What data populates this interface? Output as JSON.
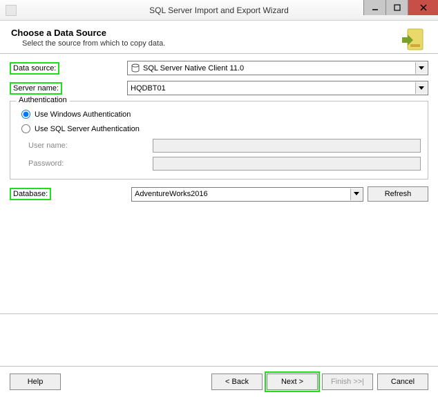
{
  "window": {
    "title": "SQL Server Import and Export Wizard"
  },
  "header": {
    "title": "Choose a Data Source",
    "subtitle": "Select the source from which to copy data."
  },
  "form": {
    "data_source_label": "Data source:",
    "data_source_value": "SQL Server Native Client 11.0",
    "server_name_label": "Server name:",
    "server_name_value": "HQDBT01",
    "database_label": "Database:",
    "database_value": "AdventureWorks2016",
    "refresh_label": "Refresh"
  },
  "auth": {
    "legend": "Authentication",
    "windows_label": "Use Windows Authentication",
    "sql_label": "Use SQL Server Authentication",
    "username_label": "User name:",
    "password_label": "Password:",
    "username_value": "",
    "password_value": ""
  },
  "footer": {
    "help": "Help",
    "back": "< Back",
    "next": "Next >",
    "finish": "Finish >>|",
    "cancel": "Cancel"
  }
}
